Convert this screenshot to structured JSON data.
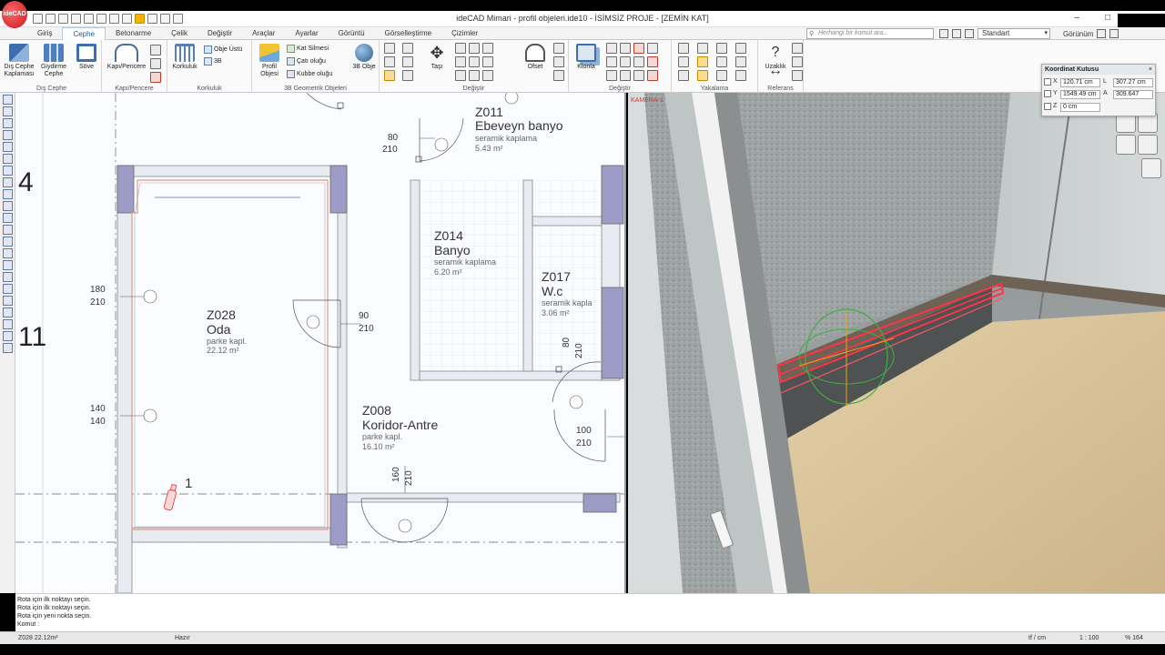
{
  "app": {
    "logo_text": "ideCAD",
    "window_title": "ideCAD Mimari - profil objeleri.ide10 - İSİMSİZ PROJE - [ZEMİN KAT]",
    "minimize": "–",
    "maximize": "□"
  },
  "menu": {
    "tabs": [
      "Giriş",
      "Cephe",
      "Betonarme",
      "Çelik",
      "Değiştir",
      "Araçlar",
      "Ayarlar",
      "Görüntü",
      "Görselleştirme",
      "Çizimler"
    ],
    "active_tab": "Cephe",
    "search_placeholder": "Herhangi bir komut ara...",
    "style_select": "Standart",
    "view_label": "Görünüm"
  },
  "ribbon": {
    "groups": [
      {
        "label": "Dış Cephe",
        "buttons": [
          "Dış Cephe Kaplaması",
          "Giydirme Cephe",
          "Söve"
        ]
      },
      {
        "label": "Kapı/Pencere",
        "buttons": [
          "Kapı/Pencere"
        ]
      },
      {
        "label": "Korkuluk",
        "buttons": [
          "Korkuluk",
          "Obje Üstü",
          "3B"
        ]
      },
      {
        "label": "3B Geometrik Objeleri",
        "buttons": [
          "Profil Objesi",
          "Kat Silmesi",
          "Çatı oluğu",
          "Kubbe oluğu",
          "3B Obje"
        ]
      },
      {
        "label": "Değiştir",
        "buttons": [
          "Taşı",
          "Ofset"
        ]
      },
      {
        "label": "Değiştir",
        "buttons": [
          "Klonla"
        ]
      },
      {
        "label": "Yakalama",
        "buttons": []
      },
      {
        "label": "Referans",
        "buttons": [
          "Uzaklık"
        ]
      }
    ]
  },
  "plan": {
    "rooms": [
      {
        "code": "Z011",
        "name": "Ebeveyn banyo",
        "finish": "seramik kaplama",
        "area": "5.43 m²"
      },
      {
        "code": "Z014",
        "name": "Banyo",
        "finish": "seramik kaplama",
        "area": "6.20 m²"
      },
      {
        "code": "Z017",
        "name": "W.c",
        "finish": "seramik kapla",
        "area": "3.06 m²"
      },
      {
        "code": "Z028",
        "name": "Oda",
        "finish": "parke kapl.",
        "area": "22.12 m²"
      },
      {
        "code": "Z008",
        "name": "Koridor-Antre",
        "finish": "parke kapl.",
        "area": "16.10 m²"
      }
    ],
    "dimensions": [
      {
        "top": "80",
        "bottom": "210"
      },
      {
        "top": "180",
        "bottom": "210"
      },
      {
        "top": "90",
        "bottom": "210"
      },
      {
        "top": "140",
        "bottom": "140"
      },
      {
        "top": "100",
        "bottom": "210"
      },
      {
        "top": "80",
        "bottom": "210"
      },
      {
        "top": "160",
        "bottom": "210"
      }
    ],
    "axis_labels": [
      "4",
      "11"
    ],
    "marker_label": "1"
  },
  "view3d": {
    "camera": "KAMERA-1"
  },
  "coord_box": {
    "title": "Koordinat Kutusu",
    "close": "×",
    "x_label": "X",
    "x_value": "120.71 cm",
    "l_label": "L",
    "l_value": "307.27 cm",
    "y_label": "Y",
    "y_value": "1549.49 cm",
    "a_label": "A",
    "a_value": "309.647",
    "z_label": "Z",
    "z_value": "0 cm"
  },
  "command": {
    "lines": [
      "Rota için ilk noktayı seçin.",
      "Rota için ilk noktayı seçin.",
      "Rota için yeni nokta seçin."
    ],
    "prompt": "Komut :"
  },
  "status": {
    "room": "Z028 22.12m²",
    "state": "Hazır",
    "units": "tf / cm",
    "scale": "1 : 100",
    "zoom": "% 164"
  }
}
